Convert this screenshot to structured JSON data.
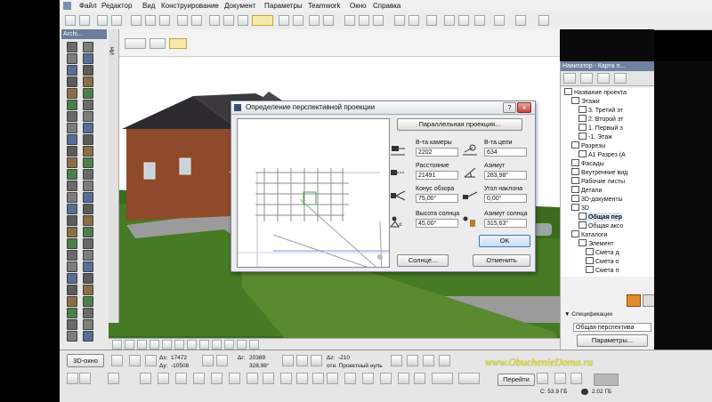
{
  "menu": [
    "Файл",
    "Редактор",
    "Вид",
    "Конструирование",
    "Документ",
    "Параметры",
    "Teamwork",
    "Окно",
    "Справка"
  ],
  "toolbox": {
    "title": "Archi..."
  },
  "viewport": {
    "tab_label": "Ин"
  },
  "dialog": {
    "title": "Определение перспективной проекции",
    "parallel_button": "Параллельная проекция...",
    "camera_height_label": "В-та камеры",
    "camera_height_value": "2202",
    "target_height_label": "В-та цели",
    "target_height_value": "634",
    "distance_label": "Расстояние",
    "distance_value": "21491",
    "azimuth_label": "Азимут",
    "azimuth_value": "283,98°",
    "view_cone_label": "Конус обзора",
    "view_cone_value": "75,00°",
    "tilt_label": "Угол наклона",
    "tilt_value": "0,00°",
    "sun_height_label": "Высота солнца",
    "sun_height_value": "45,00°",
    "sun_azimuth_label": "Азимут солнца",
    "sun_azimuth_value": "315,63°",
    "ok_button": "OK",
    "sun_button": "Солнце...",
    "cancel_button": "Отменить",
    "help_glyph": "?",
    "close_glyph": "x"
  },
  "navigator": {
    "title": "Навигатор - Карта п...",
    "items": [
      {
        "label": "Название проекта",
        "level": 0
      },
      {
        "label": "Этажи",
        "level": 1
      },
      {
        "label": "3. Третий эт",
        "level": 2
      },
      {
        "label": "2. Второй эт",
        "level": 2
      },
      {
        "label": "1. Первый э",
        "level": 2
      },
      {
        "label": "-1. Этаж",
        "level": 2
      },
      {
        "label": "Разрезы",
        "level": 1
      },
      {
        "label": "A1 Разрез (А",
        "level": 2
      },
      {
        "label": "Фасады",
        "level": 1
      },
      {
        "label": "Внутренние вид",
        "level": 1
      },
      {
        "label": "Рабочие листы",
        "level": 1
      },
      {
        "label": "Детали",
        "level": 1
      },
      {
        "label": "3D-документы",
        "level": 1
      },
      {
        "label": "3D",
        "level": 1
      },
      {
        "label": "Общая пер",
        "level": 2
      },
      {
        "label": "Общая аксо",
        "level": 2
      },
      {
        "label": "Каталоги",
        "level": 1
      },
      {
        "label": "Элемент",
        "level": 2
      },
      {
        "label": "Смета д",
        "level": 3
      },
      {
        "label": "Смета о",
        "level": 3
      },
      {
        "label": "Смета п",
        "level": 3
      }
    ],
    "specs_label": "Спецификации",
    "current_view": "Общая перспектива",
    "params_button": "Параметры..."
  },
  "infobox": {
    "view_button": "3D-окно",
    "dx_label": "Δx:",
    "dx_value": "17472",
    "dy_label": "Δy:",
    "dy_value": "-10508",
    "dr_label": "Δr:",
    "dr_value": "20389",
    "angle_value": "328,98°",
    "dz_label": "Δz:",
    "dz_value": "-210",
    "ref_label": "отн. Проектный нуль",
    "goto_button": "Перейти",
    "disk_c": "С: 53.9 ГБ",
    "disk_2": "2.02 ГБ"
  },
  "watermark": "www.ObuchenieDoma.ru"
}
